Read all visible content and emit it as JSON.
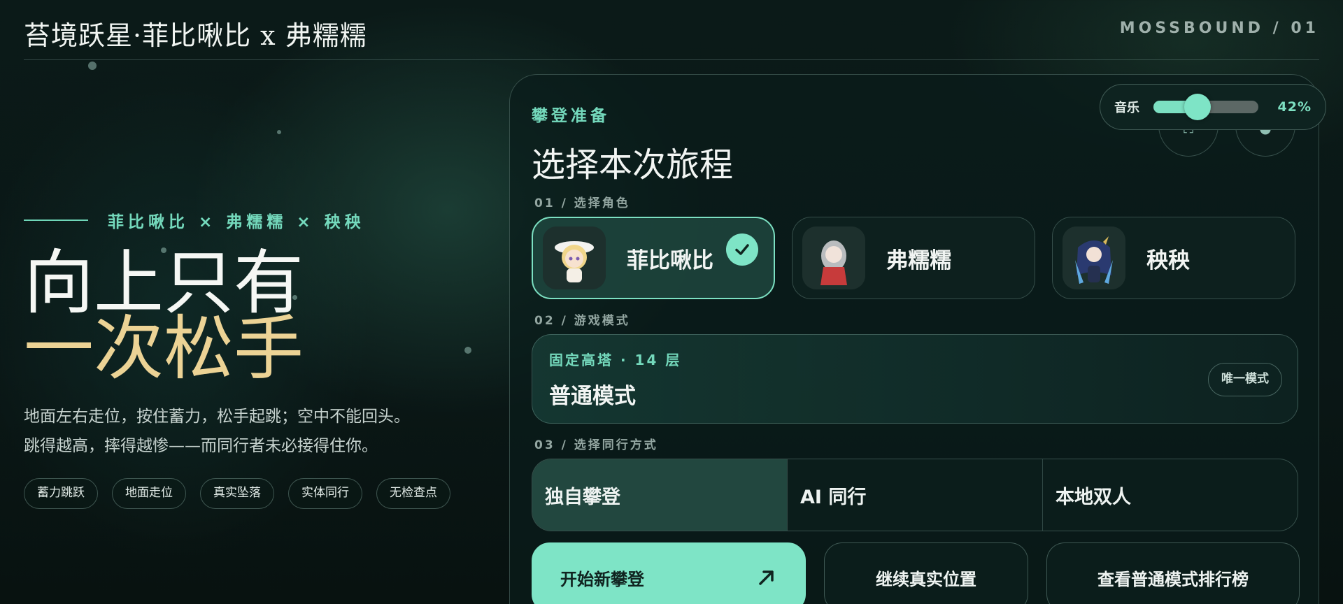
{
  "header": {
    "title": "苔境跃星·菲比啾比 x 弗糯糯",
    "code": "MOSSBOUND / 01"
  },
  "hero": {
    "credits": "菲比啾比 × 弗糯糯 × 秧秧",
    "headline_line1": "向上只有",
    "headline_line2": "一次松手",
    "desc_line1": "地面左右走位，按住蓄力，松手起跳；空中不能回头。",
    "desc_line2": "跳得越高，摔得越惨——而同行者未必接得住你。",
    "tags": [
      "蓄力跳跃",
      "地面走位",
      "真实坠落",
      "实体同行",
      "无检查点"
    ]
  },
  "music": {
    "label": "音乐",
    "value_percent": 42,
    "value_text": "42%"
  },
  "panel": {
    "eyebrow": "攀登准备",
    "title": "选择本次旅程",
    "step1": "01 / 选择角色",
    "step2": "02 / 游戏模式",
    "step3": "03 / 选择同行方式",
    "characters": [
      {
        "name": "菲比啾比",
        "selected": true
      },
      {
        "name": "弗糯糯",
        "selected": false
      },
      {
        "name": "秧秧",
        "selected": false
      }
    ],
    "mode": {
      "meta": "固定高塔 · 14 层",
      "name": "普通模式",
      "badge": "唯一模式"
    },
    "company": [
      "独自攀登",
      "AI 同行",
      "本地双人"
    ],
    "actions": {
      "start": "开始新攀登",
      "continue": "继续真实位置",
      "rank": "查看普通模式排行榜"
    }
  },
  "colors": {
    "accent": "#7ee4c6",
    "gold": "#ecd395",
    "background": "#0b1a18"
  }
}
